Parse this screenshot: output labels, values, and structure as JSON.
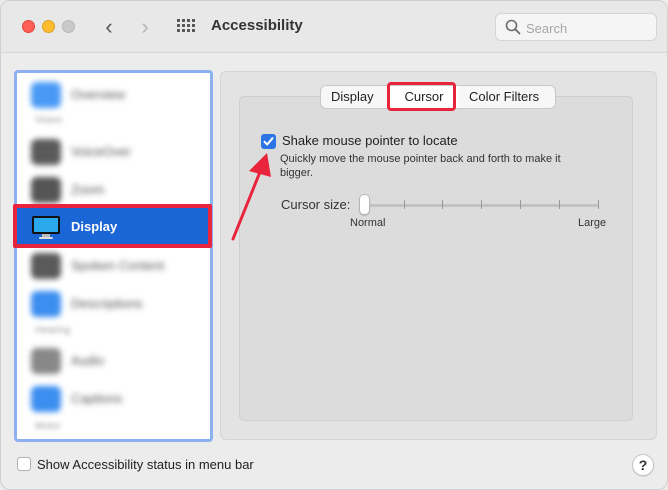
{
  "window": {
    "title": "Accessibility",
    "nav": {
      "back_glyph": "‹",
      "forward_glyph": "›"
    }
  },
  "search": {
    "placeholder": "Search",
    "value": ""
  },
  "sidebar": {
    "items": [
      {
        "label": "Overview",
        "icon": "info-icon",
        "color": "#4a9af5",
        "blurred": true
      },
      {
        "label": "VoiceOver",
        "icon": "voiceover-icon",
        "color": "#5a5a5a",
        "blurred": true
      },
      {
        "label": "Zoom",
        "icon": "zoom-icon",
        "color": "#555555",
        "blurred": true
      },
      {
        "label": "Display",
        "icon": "display-icon",
        "color": "#1a66d6",
        "blurred": false,
        "selected": true
      },
      {
        "label": "Spoken Content",
        "icon": "speech-icon",
        "color": "#5a5a5a",
        "blurred": true
      },
      {
        "label": "Descriptions",
        "icon": "descriptions-icon",
        "color": "#3c8ef0",
        "blurred": true
      },
      {
        "label": "Audio",
        "icon": "audio-icon",
        "color": "#888888",
        "blurred": true
      },
      {
        "label": "Captions",
        "icon": "captions-icon",
        "color": "#3c8ef0",
        "blurred": true
      }
    ],
    "sections": [
      "Vision",
      "Hearing",
      "Motor"
    ]
  },
  "tabs": [
    {
      "label": "Display",
      "selected": false
    },
    {
      "label": "Cursor",
      "selected": true
    },
    {
      "label": "Color Filters",
      "selected": false
    }
  ],
  "cursor": {
    "shake_label": "Shake mouse pointer to locate",
    "shake_checked": true,
    "shake_desc": "Quickly move the mouse pointer back and forth to make it bigger.",
    "size_label": "Cursor size:",
    "size_min_label": "Normal",
    "size_max_label": "Large",
    "size_value_fraction": 0.0
  },
  "footer": {
    "status_menu_label": "Show Accessibility status in menu bar",
    "status_menu_checked": false,
    "help_label": "?"
  },
  "colors": {
    "highlight_red": "#e8253c",
    "selection_blue": "#1a66d6",
    "checkbox_blue": "#2a74e4"
  }
}
